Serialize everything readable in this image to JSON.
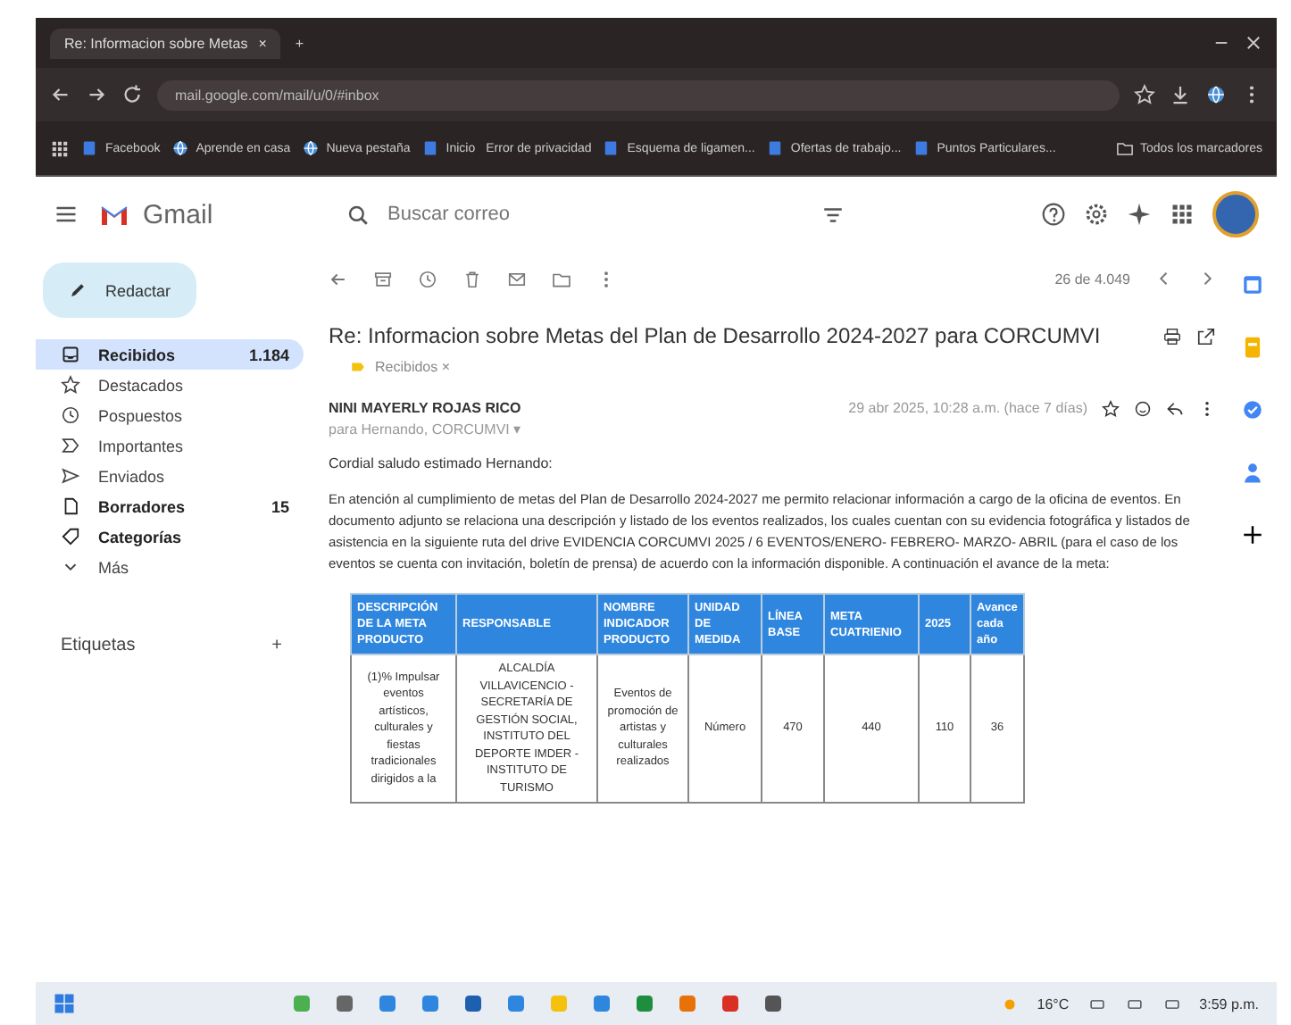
{
  "browser": {
    "tab_title": "Re: Informacion sobre Metas",
    "tab_close": "×",
    "new_tab": "+",
    "url": "mail.google.com/mail/u/0/#inbox",
    "bookmarks": [
      "Facebook",
      "Aprende en casa",
      "Nueva pestaña",
      "Inicio",
      "Error de privacidad",
      "Esquema de ligamen...",
      "Ofertas de trabajo...",
      "Puntos Particulares..."
    ],
    "all_bookmarks": "Todos los marcadores"
  },
  "gmail": {
    "app_name": "Gmail",
    "search": {
      "placeholder": "Buscar correo"
    }
  },
  "sidebar": {
    "compose": "Redactar",
    "items": [
      {
        "kind": "inbox",
        "label": "Recibidos",
        "count": "1.184",
        "selected": true,
        "bold": true
      },
      {
        "kind": "star",
        "label": "Destacados",
        "selected": false,
        "bold": false
      },
      {
        "kind": "clock",
        "label": "Pospuestos",
        "selected": false,
        "bold": false
      },
      {
        "kind": "important",
        "label": "Importantes",
        "selected": false,
        "bold": false
      },
      {
        "kind": "send",
        "label": "Enviados",
        "selected": false,
        "bold": false
      },
      {
        "kind": "draft",
        "label": "Borradores",
        "count": "15",
        "selected": false,
        "bold": true
      },
      {
        "kind": "category",
        "label": "Categorías",
        "selected": false,
        "bold": true
      },
      {
        "kind": "more",
        "label": "Más",
        "selected": false,
        "bold": false
      }
    ],
    "labels_heading": "Etiquetas",
    "labels_add": "+"
  },
  "message": {
    "counter": "26 de 4.049",
    "subject": "Re: Informacion sobre Metas del Plan de Desarrollo 2024-2027 para CORCUMVI",
    "label_chip": "Recibidos ×",
    "sender": "NINI MAYERLY ROJAS RICO",
    "recipients": "para Hernando, CORCUMVI ▾",
    "date": "29 abr 2025, 10:28 a.m. (hace 7 días)",
    "greeting": "Cordial saludo estimado Hernando:",
    "body": "En atención al cumplimiento de metas del Plan de Desarrollo 2024-2027 me permito relacionar información a cargo de la oficina de eventos. En documento adjunto se relaciona una descripción y listado de los eventos realizados, los cuales cuentan con su evidencia fotográfica y listados de asistencia en la siguiente ruta del drive EVIDENCIA CORCUMVI 2025 / 6 EVENTOS/ENERO- FEBRERO- MARZO- ABRIL (para el caso de los eventos se cuenta con invitación, boletín de prensa) de acuerdo con la información disponible. A continuación el avance de la meta:",
    "table": {
      "columns": [
        "DESCRIPCIÓN DE LA META PRODUCTO",
        "RESPONSABLE",
        "NOMBRE INDICADOR PRODUCTO",
        "UNIDAD DE MEDIDA",
        "LÍNEA BASE",
        "META CUATRIENIO",
        "2025",
        "Avance cada año"
      ],
      "rows": [
        [
          "(1)% Impulsar eventos artísticos, culturales y fiestas tradicionales dirigidos a la",
          "ALCALDÍA VILLAVICENCIO -SECRETARÍA DE GESTIÓN SOCIAL, INSTITUTO DEL DEPORTE IMDER -INSTITUTO DE TURISMO",
          "Eventos de promoción de artistas y culturales realizados",
          "Número",
          "470",
          "440",
          "110",
          "36"
        ]
      ]
    }
  },
  "taskbar": {
    "temperature": "16°C",
    "time": "3:59 p.m."
  }
}
